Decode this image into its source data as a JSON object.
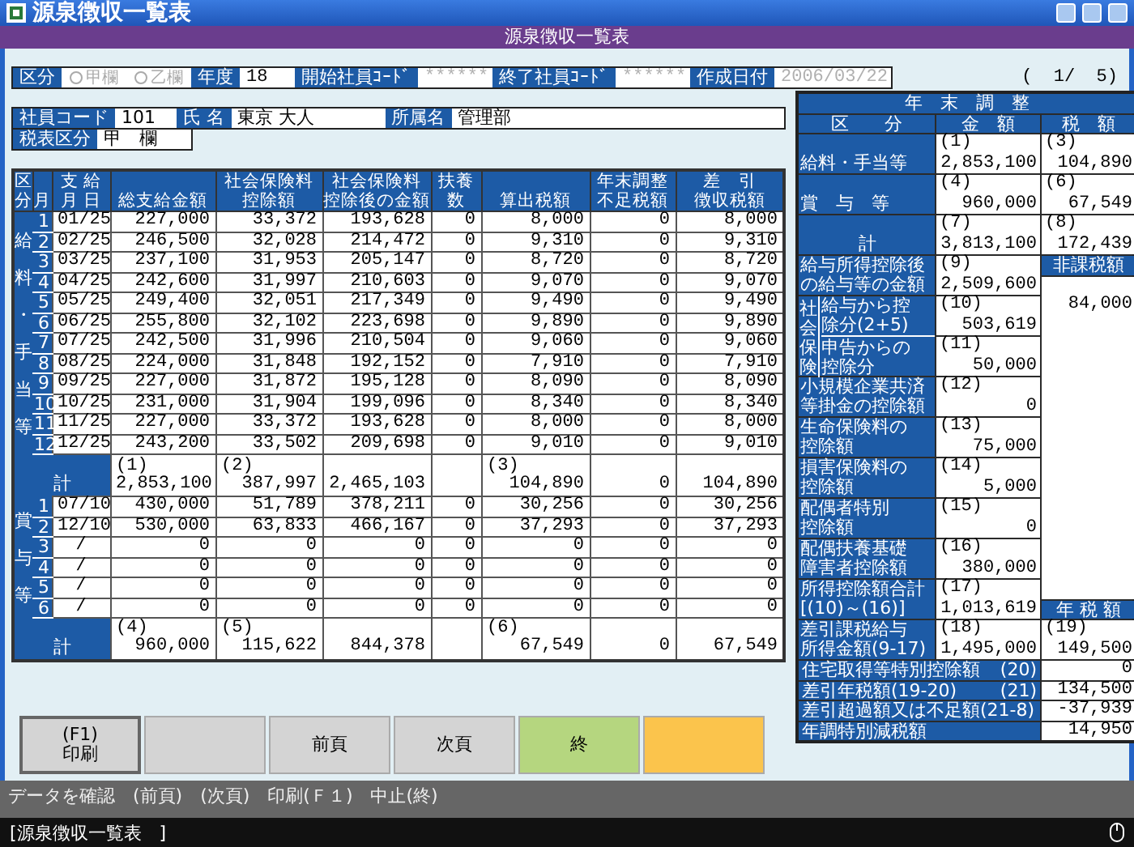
{
  "window": {
    "title": "源泉徴収一覧表"
  },
  "header_bar": {
    "title": "源泉徴収一覧表"
  },
  "filters": {
    "kubun": {
      "label": "区分",
      "options": [
        {
          "label": "甲欄",
          "selected": false
        },
        {
          "label": "乙欄",
          "selected": false
        }
      ]
    },
    "fields": [
      {
        "label": "年度",
        "value": "18",
        "disabled": false
      },
      {
        "label": "開始社員ｺｰﾄﾞ",
        "value": "******",
        "disabled": true
      },
      {
        "label": "終了社員ｺｰﾄﾞ",
        "value": "******",
        "disabled": true
      },
      {
        "label": "作成日付",
        "value": "2006/03/22",
        "disabled": true
      }
    ]
  },
  "page_indicator": "(  1/  5)",
  "employee": {
    "fields": [
      {
        "label": "社員コード",
        "value": "101"
      },
      {
        "label": "氏 名",
        "value": "東京 大人"
      },
      {
        "label": "所属名",
        "value": "管理部"
      }
    ],
    "tax_class": {
      "label": "税表区分",
      "value": "甲　欄"
    }
  },
  "table": {
    "columns": [
      [
        "区",
        "分"
      ],
      [
        "月"
      ],
      [
        "支 給",
        "月 日"
      ],
      [
        "総支給金額"
      ],
      [
        "社会保険料",
        "控除額"
      ],
      [
        "社会保険料",
        "控除後の金額"
      ],
      [
        "扶養",
        "数"
      ],
      [
        "算出税額"
      ],
      [
        "年末調整",
        "不足税額"
      ],
      [
        "差　引",
        "徴収税額"
      ]
    ],
    "sections": [
      {
        "label": "給料・手当等",
        "rows": [
          {
            "month": "1",
            "date": "01/25",
            "values": [
              "227,000",
              "33,372",
              "193,628",
              "0",
              "8,000",
              "0",
              "8,000"
            ]
          },
          {
            "month": "2",
            "date": "02/25",
            "values": [
              "246,500",
              "32,028",
              "214,472",
              "0",
              "9,310",
              "0",
              "9,310"
            ]
          },
          {
            "month": "3",
            "date": "03/25",
            "values": [
              "237,100",
              "31,953",
              "205,147",
              "0",
              "8,720",
              "0",
              "8,720"
            ]
          },
          {
            "month": "4",
            "date": "04/25",
            "values": [
              "242,600",
              "31,997",
              "210,603",
              "0",
              "9,070",
              "0",
              "9,070"
            ]
          },
          {
            "month": "5",
            "date": "05/25",
            "values": [
              "249,400",
              "32,051",
              "217,349",
              "0",
              "9,490",
              "0",
              "9,490"
            ]
          },
          {
            "month": "6",
            "date": "06/25",
            "values": [
              "255,800",
              "32,102",
              "223,698",
              "0",
              "9,890",
              "0",
              "9,890"
            ]
          },
          {
            "month": "7",
            "date": "07/25",
            "values": [
              "242,500",
              "31,996",
              "210,504",
              "0",
              "9,060",
              "0",
              "9,060"
            ]
          },
          {
            "month": "8",
            "date": "08/25",
            "values": [
              "224,000",
              "31,848",
              "192,152",
              "0",
              "7,910",
              "0",
              "7,910"
            ]
          },
          {
            "month": "9",
            "date": "09/25",
            "values": [
              "227,000",
              "31,872",
              "195,128",
              "0",
              "8,090",
              "0",
              "8,090"
            ]
          },
          {
            "month": "10",
            "date": "10/25",
            "values": [
              "231,000",
              "31,904",
              "199,096",
              "0",
              "8,340",
              "0",
              "8,340"
            ]
          },
          {
            "month": "11",
            "date": "11/25",
            "values": [
              "227,000",
              "33,372",
              "193,628",
              "0",
              "8,000",
              "0",
              "8,000"
            ]
          },
          {
            "month": "12",
            "date": "12/25",
            "values": [
              "243,200",
              "33,502",
              "209,698",
              "0",
              "9,010",
              "0",
              "9,010"
            ]
          }
        ],
        "total": {
          "label": "計",
          "cells": [
            {
              "ref": "(1)",
              "value": "2,853,100"
            },
            {
              "ref": "(2)",
              "value": "387,997"
            },
            {
              "value": "2,465,103"
            },
            null,
            {
              "ref": "(3)",
              "value": "104,890"
            },
            {
              "value": "0"
            },
            {
              "value": "104,890"
            }
          ]
        }
      },
      {
        "label": "賞与等",
        "rows": [
          {
            "month": "1",
            "date": "07/10",
            "values": [
              "430,000",
              "51,789",
              "378,211",
              "0",
              "30,256",
              "0",
              "30,256"
            ]
          },
          {
            "month": "2",
            "date": "12/10",
            "values": [
              "530,000",
              "63,833",
              "466,167",
              "0",
              "37,293",
              "0",
              "37,293"
            ]
          },
          {
            "month": "3",
            "date": "/",
            "values": [
              "0",
              "0",
              "0",
              "0",
              "0",
              "0",
              "0"
            ]
          },
          {
            "month": "4",
            "date": "/",
            "values": [
              "0",
              "0",
              "0",
              "0",
              "0",
              "0",
              "0"
            ]
          },
          {
            "month": "5",
            "date": "/",
            "values": [
              "0",
              "0",
              "0",
              "0",
              "0",
              "0",
              "0"
            ]
          },
          {
            "month": "6",
            "date": "/",
            "values": [
              "0",
              "0",
              "0",
              "0",
              "0",
              "0",
              "0"
            ]
          }
        ],
        "total": {
          "label": "計",
          "cells": [
            {
              "ref": "(4)",
              "value": "960,000"
            },
            {
              "ref": "(5)",
              "value": "115,622"
            },
            {
              "value": "844,378"
            },
            null,
            {
              "ref": "(6)",
              "value": "67,549"
            },
            {
              "value": "0"
            },
            {
              "value": "67,549"
            }
          ]
        }
      }
    ]
  },
  "year_end": {
    "title": "年　末　調　整",
    "columns": [
      "区　　分",
      "金　額",
      "税　額"
    ],
    "non_taxable": {
      "label": "非課税額",
      "value": "84,000"
    },
    "annual_tax_label": "年 税 額",
    "rows": [
      {
        "kind": "pair",
        "label": [
          "給料・手当等"
        ],
        "centered": false,
        "amount": {
          "ref": "(1)",
          "value": "2,853,100"
        },
        "tax": {
          "ref": "(3)",
          "value": "104,890"
        }
      },
      {
        "kind": "pair",
        "label": [
          "賞　与　等"
        ],
        "centered": false,
        "amount": {
          "ref": "(4)",
          "value": "960,000"
        },
        "tax": {
          "ref": "(6)",
          "value": "67,549"
        }
      },
      {
        "kind": "pair",
        "label": [
          "計"
        ],
        "centered": true,
        "amount": {
          "ref": "(7)",
          "value": "3,813,100"
        },
        "tax": {
          "ref": "(8)",
          "value": "172,439"
        }
      },
      {
        "kind": "amount",
        "label": [
          "給与所得控除後",
          "の給与等の金額"
        ],
        "amount": {
          "ref": "(9)",
          "value": "2,509,600"
        }
      },
      {
        "kind": "group",
        "label": "社会保険",
        "items": [
          {
            "label": [
              "給与から控",
              "除分(2+5)"
            ],
            "amount": {
              "ref": "(10)",
              "value": "503,619"
            }
          },
          {
            "label": [
              "申告からの",
              "控除分"
            ],
            "amount": {
              "ref": "(11)",
              "value": "50,000"
            }
          }
        ]
      },
      {
        "kind": "amount",
        "label": [
          "小規模企業共済",
          "等掛金の控除額"
        ],
        "amount": {
          "ref": "(12)",
          "value": "0"
        }
      },
      {
        "kind": "amount",
        "label": [
          "生命保険料の",
          "控除額"
        ],
        "amount": {
          "ref": "(13)",
          "value": "75,000"
        }
      },
      {
        "kind": "amount",
        "label": [
          "損害保険料の",
          "控除額"
        ],
        "amount": {
          "ref": "(14)",
          "value": "5,000"
        }
      },
      {
        "kind": "amount",
        "label": [
          "配偶者特別",
          "控除額"
        ],
        "amount": {
          "ref": "(15)",
          "value": "0"
        }
      },
      {
        "kind": "amount",
        "label": [
          "配偶扶養基礎",
          "障害者控除額"
        ],
        "amount": {
          "ref": "(16)",
          "value": "380,000"
        }
      },
      {
        "kind": "amount",
        "label": [
          "所得控除額合計",
          "[(10)～(16)]"
        ],
        "amount": {
          "ref": "(17)",
          "value": "1,013,619"
        }
      },
      {
        "kind": "pair",
        "label": [
          "差引課税給与",
          "所得金額(9-17)"
        ],
        "centered": false,
        "amount": {
          "ref": "(18)",
          "value": "1,495,000"
        },
        "tax": {
          "ref": "(19)",
          "value": "149,500"
        }
      },
      {
        "kind": "single",
        "label": "住宅取得等特別控除額",
        "ref": "(20)",
        "value": "0"
      },
      {
        "kind": "single",
        "label": "差引年税額(19-20)",
        "ref": "(21)",
        "value": "134,500"
      },
      {
        "kind": "single",
        "label": "差引超過額又は不足額(21-8)",
        "value": "-37,939"
      },
      {
        "kind": "single",
        "label": "年調特別減税額",
        "value": "14,950"
      }
    ]
  },
  "buttons": [
    {
      "label": "(F1)\n印刷",
      "color": "#d4d4d4",
      "focused": true
    },
    {
      "color": "#d4d4d4",
      "focused": false
    },
    {
      "label": "前頁",
      "color": "#d4d4d4",
      "focused": false
    },
    {
      "label": "次頁",
      "color": "#d4d4d4",
      "focused": false
    },
    {
      "label": "終",
      "color": "#b5d67f",
      "focused": false
    },
    {
      "color": "#fbc44c",
      "focused": false
    }
  ],
  "hint": "データを確認　(前頁)　(次頁)　印刷(Ｆ１)　中止(終)",
  "status_bar": {
    "text": "[源泉徴収一覧表　]"
  }
}
